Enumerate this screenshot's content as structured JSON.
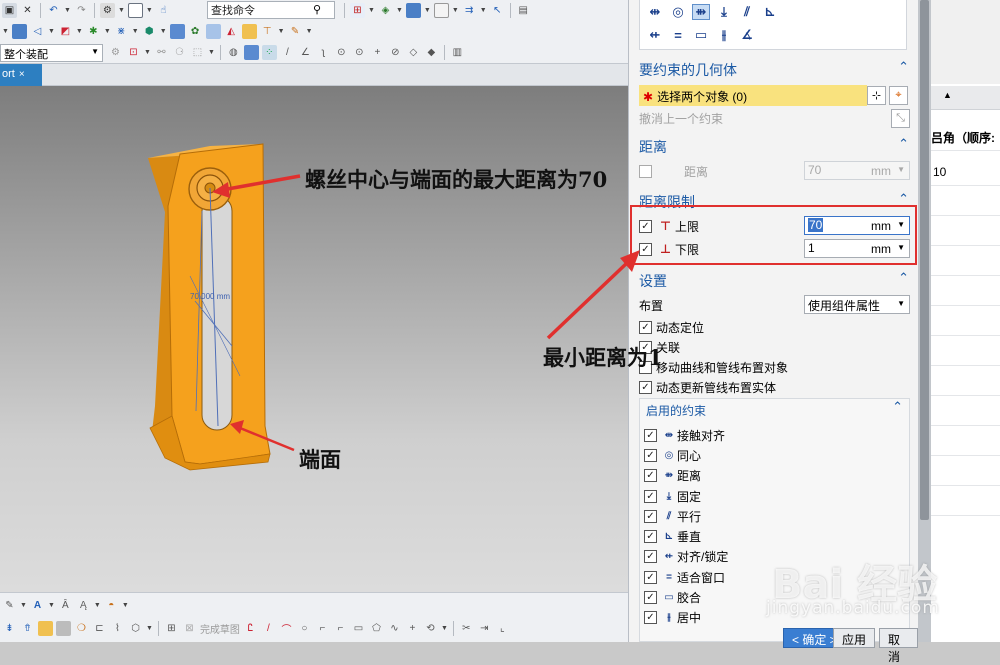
{
  "toolbar": {
    "command_search_value": "查找命令",
    "selection_filter_value": "整个装配"
  },
  "doc_tab": {
    "label": "ort",
    "close": "×"
  },
  "viewport": {
    "dimension_label": "70.000 mm",
    "callout_top": "螺丝中心与端面的最大距离为70",
    "callout_end": "端面",
    "callout_min": "最小距离为1"
  },
  "bottom_toolbar": {
    "finish_sketch_label": "完成草图"
  },
  "dialog": {
    "geometry_section": {
      "title": "要约束的几何体",
      "select_label": "选择两个对象 (0)",
      "undo_label": "撤消上一个约束"
    },
    "distance_section": {
      "title": "距离",
      "distance_label": "距离",
      "distance_value": "70",
      "unit": "mm"
    },
    "limits_section": {
      "title": "距离限制",
      "upper_label": "上限",
      "upper_value": "70",
      "lower_label": "下限",
      "lower_value": "1",
      "unit": "mm"
    },
    "settings_section": {
      "title": "设置",
      "arrangement_label": "布置",
      "arrangement_value": "使用组件属性",
      "opt_dynamic_position": "动态定位",
      "opt_associative": "关联",
      "opt_move_curves": "移动曲线和管线布置对象",
      "opt_dynamic_update": "动态更新管线布置实体"
    },
    "enabled_constraints": {
      "title": "启用的约束",
      "items": [
        "接触对齐",
        "同心",
        "距离",
        "固定",
        "平行",
        "垂直",
        "对齐/锁定",
        "适合窗口",
        "胶合",
        "居中"
      ]
    },
    "buttons": {
      "ok": "< 确定 >",
      "apply": "应用",
      "cancel": "取消"
    }
  },
  "right_panel": {
    "header_text": "吕角（顺序:",
    "value": "10"
  },
  "watermark": {
    "brand": "Bai 经验",
    "url": "jingyan.baidu.com"
  },
  "colors": {
    "part_orange": "#f5a11d",
    "callout_red": "#e0302e",
    "selection_yellow": "#f9e27e",
    "section_blue": "#1c5aa5"
  }
}
